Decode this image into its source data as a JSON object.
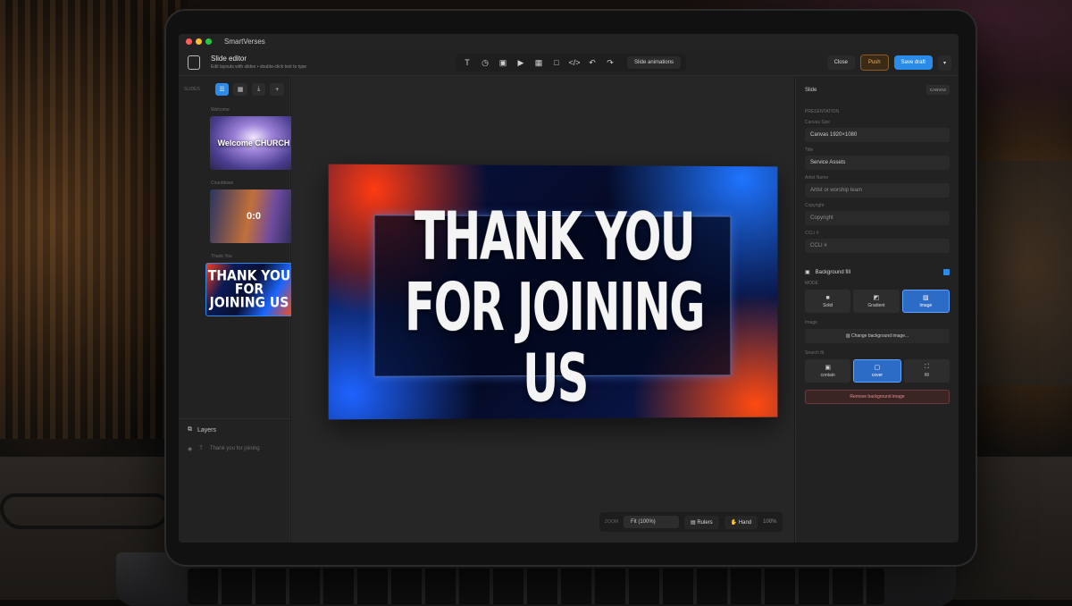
{
  "app": {
    "title": "SmartVerses"
  },
  "toolbar": {
    "title": "Slide editor",
    "subtitle": "Edit layouts with slides • double-click text to type",
    "tools": [
      "T",
      "◷",
      "▣",
      "▶",
      "▦",
      "□",
      "</>",
      "↶",
      "↷"
    ],
    "slide_animations": "Slide animations",
    "close": "Close",
    "push": "Push",
    "save_draft": "Save draft",
    "more": "▾"
  },
  "left_panel": {
    "header_label": "SLIDES",
    "sections": [
      "Welcome",
      "Countdown",
      "Thank You"
    ],
    "thumbs": [
      "Welcome CHURCH",
      "0:0",
      "THANK YOU FOR JOINING US"
    ],
    "layers_title": "Layers",
    "layer_item": "Thank you for joining"
  },
  "slide": {
    "text": "THANK YOU FOR JOINING US"
  },
  "zoom": {
    "label": "ZOOM",
    "fit": "Fit (100%)",
    "rulers": "Rulers",
    "hand": "Hand",
    "percent": "100%"
  },
  "right_panel": {
    "title": "Slide",
    "chip": "CANVAS",
    "presentation_label": "PRESENTATION",
    "canvas_size_label": "Canvas Size",
    "canvas_size": "Canvas 1920×1080",
    "title_label": "Title",
    "title_value": "Service Assets",
    "artist_label": "Artist Name",
    "artist_value": "Artist or worship team",
    "copyright_label": "Copyright",
    "copyright_value": "Copyright",
    "ccli_label": "CCLI #",
    "ccli_value": "CCLI #",
    "bg_fill": "Background fill",
    "mode_label": "MODE",
    "modes": [
      "Solid",
      "Gradient",
      "Image"
    ],
    "image_label": "Image",
    "change_bg": "Change background image...",
    "search_label": "Search fit",
    "fits": [
      "contain",
      "cover",
      "fill"
    ],
    "remove_bg": "Remove background image"
  }
}
